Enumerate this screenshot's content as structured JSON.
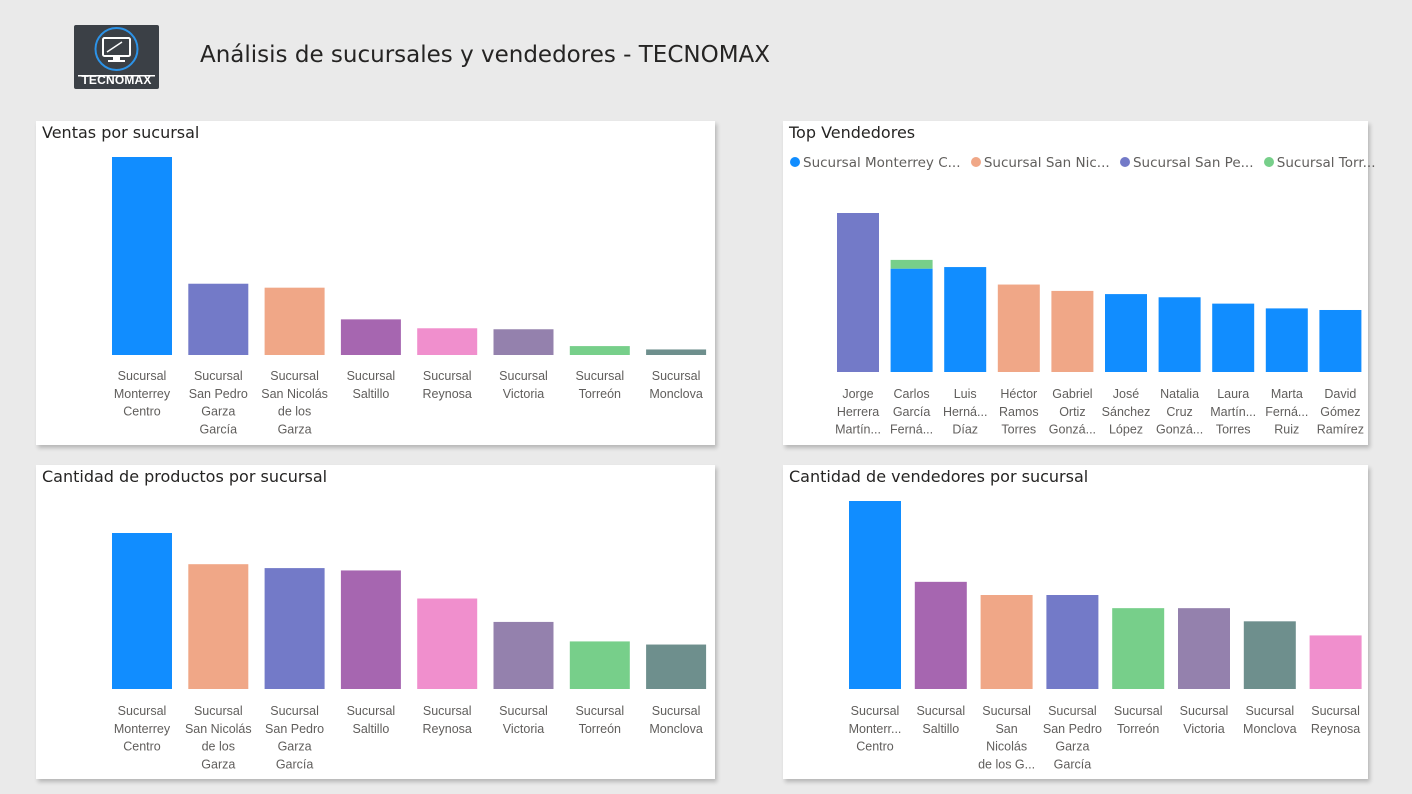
{
  "header": {
    "title": "Análisis de sucursales y vendedores - TECNOMAX",
    "logo_text": "TECNOMAX"
  },
  "colors": {
    "blue": "#118dff",
    "indigo": "#737ac8",
    "salmon": "#f0a787",
    "purple": "#a666b0",
    "pink": "#f08fcd",
    "mauve": "#9481ad",
    "green": "#77cf8a",
    "slate": "#6e8f8d"
  },
  "chart_data": [
    {
      "id": "ventas",
      "type": "bar",
      "title": "Ventas por sucursal",
      "categories": [
        [
          "Sucursal",
          "Monterrey",
          "Centro"
        ],
        [
          "Sucursal",
          "San Pedro",
          "Garza",
          "García"
        ],
        [
          "Sucursal",
          "San Nicolás",
          "de los",
          "Garza"
        ],
        [
          "Sucursal",
          "Saltillo"
        ],
        [
          "Sucursal",
          "Reynosa"
        ],
        [
          "Sucursal",
          "Victoria"
        ],
        [
          "Sucursal",
          "Torreón"
        ],
        [
          "Sucursal",
          "Monclova"
        ]
      ],
      "values": [
        100,
        36,
        34,
        18,
        13.5,
        13,
        4.5,
        2.8
      ],
      "colors": [
        "#118dff",
        "#737ac8",
        "#f0a787",
        "#a666b0",
        "#f08fcd",
        "#9481ad",
        "#77cf8a",
        "#6e8f8d"
      ],
      "ylim": [
        0,
        100
      ],
      "grid": false
    },
    {
      "id": "top",
      "type": "bar",
      "stacked": true,
      "title": "Top Vendedores",
      "legend": {
        "position": "top-left",
        "items": [
          {
            "label": "Sucursal Monterrey C...",
            "color": "#118dff"
          },
          {
            "label": "Sucursal San Nic...",
            "color": "#f0a787"
          },
          {
            "label": "Sucursal San Pe...",
            "color": "#737ac8"
          },
          {
            "label": "Sucursal Torr...",
            "color": "#77cf8a"
          }
        ]
      },
      "categories": [
        [
          "Jorge",
          "Herrera",
          "Martín..."
        ],
        [
          "Carlos",
          "García",
          "Ferná..."
        ],
        [
          "Luis",
          "Herná...",
          "Díaz"
        ],
        [
          "Héctor",
          "Ramos",
          "Torres"
        ],
        [
          "Gabriel",
          "Ortiz",
          "Gonzá..."
        ],
        [
          "José",
          "Sánchez",
          "López"
        ],
        [
          "Natalia",
          "Cruz",
          "Gonzá..."
        ],
        [
          "Laura",
          "Martín...",
          "Torres"
        ],
        [
          "Marta",
          "Ferná...",
          "Ruiz"
        ],
        [
          "David",
          "Gómez",
          "Ramírez"
        ]
      ],
      "segments": [
        [
          {
            "value": 100,
            "color": "#737ac8"
          }
        ],
        [
          {
            "value": 65,
            "color": "#118dff"
          },
          {
            "value": 5.5,
            "color": "#77cf8a"
          }
        ],
        [
          {
            "value": 66,
            "color": "#118dff"
          }
        ],
        [
          {
            "value": 55,
            "color": "#f0a787"
          }
        ],
        [
          {
            "value": 51,
            "color": "#f0a787"
          }
        ],
        [
          {
            "value": 49,
            "color": "#118dff"
          }
        ],
        [
          {
            "value": 47,
            "color": "#118dff"
          }
        ],
        [
          {
            "value": 43,
            "color": "#118dff"
          }
        ],
        [
          {
            "value": 40,
            "color": "#118dff"
          }
        ],
        [
          {
            "value": 39,
            "color": "#118dff"
          }
        ]
      ],
      "ylim": [
        0,
        100
      ],
      "grid": false
    },
    {
      "id": "productos",
      "type": "bar",
      "title": "Cantidad de productos por sucursal",
      "categories": [
        [
          "Sucursal",
          "Monterrey",
          "Centro"
        ],
        [
          "Sucursal",
          "San Nicolás",
          "de los",
          "Garza"
        ],
        [
          "Sucursal",
          "San Pedro",
          "Garza",
          "García"
        ],
        [
          "Sucursal",
          "Saltillo"
        ],
        [
          "Sucursal",
          "Reynosa"
        ],
        [
          "Sucursal",
          "Victoria"
        ],
        [
          "Sucursal",
          "Torreón"
        ],
        [
          "Sucursal",
          "Monclova"
        ]
      ],
      "values": [
        100,
        80,
        77.5,
        76,
        58,
        43,
        30.5,
        28.5
      ],
      "colors": [
        "#118dff",
        "#f0a787",
        "#737ac8",
        "#a666b0",
        "#f08fcd",
        "#9481ad",
        "#77cf8a",
        "#6e8f8d"
      ],
      "ylim": [
        0,
        100
      ],
      "grid": false
    },
    {
      "id": "vendedores",
      "type": "bar",
      "title": "Cantidad de vendedores por sucursal",
      "categories": [
        [
          "Sucursal",
          "Monterr...",
          "Centro"
        ],
        [
          "Sucursal",
          "Saltillo"
        ],
        [
          "Sucursal",
          "San",
          "Nicolás",
          "de los G..."
        ],
        [
          "Sucursal",
          "San Pedro",
          "Garza",
          "García"
        ],
        [
          "Sucursal",
          "Torreón"
        ],
        [
          "Sucursal",
          "Victoria"
        ],
        [
          "Sucursal",
          "Monclova"
        ],
        [
          "Sucursal",
          "Reynosa"
        ]
      ],
      "values": [
        100,
        57,
        50,
        50,
        43,
        43,
        36,
        28.5
      ],
      "colors": [
        "#118dff",
        "#a666b0",
        "#f0a787",
        "#737ac8",
        "#77cf8a",
        "#9481ad",
        "#6e8f8d",
        "#f08fcd"
      ],
      "ylim": [
        0,
        100
      ],
      "grid": false
    }
  ]
}
